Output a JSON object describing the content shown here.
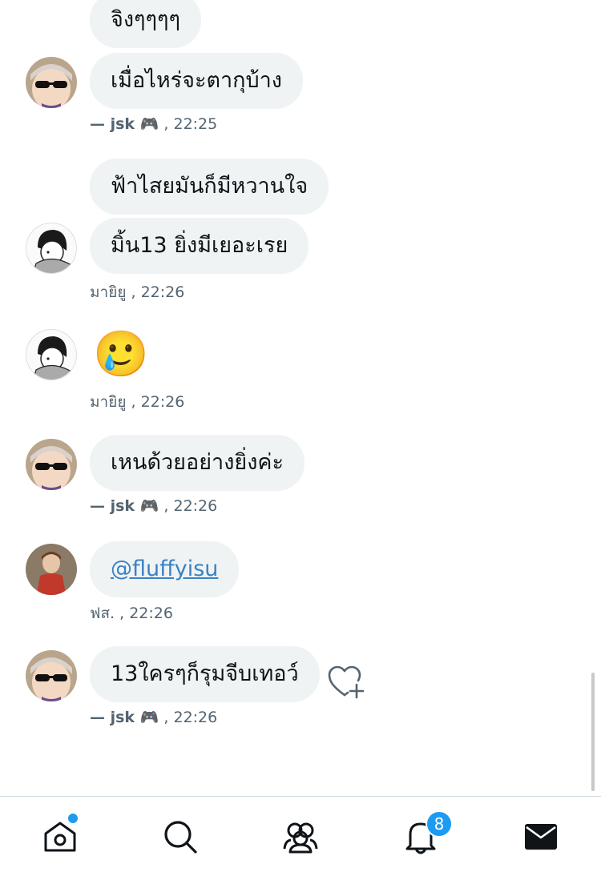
{
  "messages": [
    {
      "text": "จิงๆๆๆๆ"
    },
    {
      "text": "เมื่อไหร่จะตากุบ้าง"
    },
    {
      "text": "ฟ้าไสยมันก็มีหวานใจ"
    },
    {
      "text": "มิ้น13 ยิ่งมีเยอะเรย"
    },
    {
      "text": "🥲"
    },
    {
      "text": "เหนด้วยอย่างยิ่งค่ะ"
    },
    {
      "text": "@fluffyisu"
    },
    {
      "text": "13ใครๆก็รุมจีบเทอว์"
    }
  ],
  "meta": [
    {
      "sender": "— jsk 🎮",
      "time": " , 22:25"
    },
    {
      "sender": "มายิยู",
      "time": " , 22:26"
    },
    {
      "sender": "มายิยู",
      "time": " , 22:26"
    },
    {
      "sender": "— jsk 🎮",
      "time": " , 22:26"
    },
    {
      "sender": "ฟส.",
      "time": " , 22:26"
    },
    {
      "sender": "— jsk 🎮",
      "time": " , 22:26"
    }
  ],
  "tabs": {
    "home": {
      "icon": "home-icon",
      "has_dot": true
    },
    "search": {
      "icon": "search-icon"
    },
    "communities": {
      "icon": "communities-icon"
    },
    "notifications": {
      "icon": "bell-icon",
      "badge": "8"
    },
    "messages": {
      "icon": "mail-icon"
    }
  },
  "colors": {
    "bubble": "#eff3f4",
    "accent": "#1d9bf0",
    "meta_text": "#536471",
    "link": "#3b82c4"
  }
}
